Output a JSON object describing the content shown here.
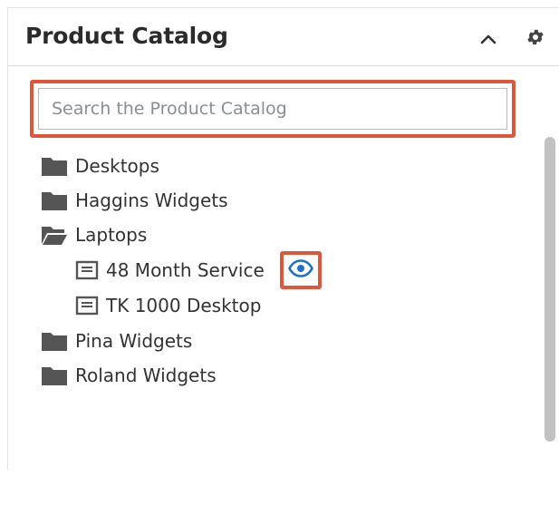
{
  "panel": {
    "title": "Product Catalog",
    "collapse_icon": "chevron-up-icon",
    "settings_icon": "gear-icon"
  },
  "search": {
    "placeholder": "Search the Product Catalog",
    "value": ""
  },
  "tree": {
    "items": [
      {
        "label": "Desktops",
        "type": "folder",
        "state": "closed"
      },
      {
        "label": "Haggins Widgets",
        "type": "folder",
        "state": "closed"
      },
      {
        "label": "Laptops",
        "type": "folder",
        "state": "open"
      },
      {
        "label": "48 Month Service",
        "type": "product",
        "preview_icon": "eye-icon"
      },
      {
        "label": "TK 1000 Desktop",
        "type": "product"
      },
      {
        "label": "Pina Widgets",
        "type": "folder",
        "state": "closed"
      },
      {
        "label": "Roland Widgets",
        "type": "folder",
        "state": "closed"
      }
    ]
  },
  "colors": {
    "highlight": "#e0563a",
    "eye": "#1e73c9",
    "folder": "#555555"
  }
}
